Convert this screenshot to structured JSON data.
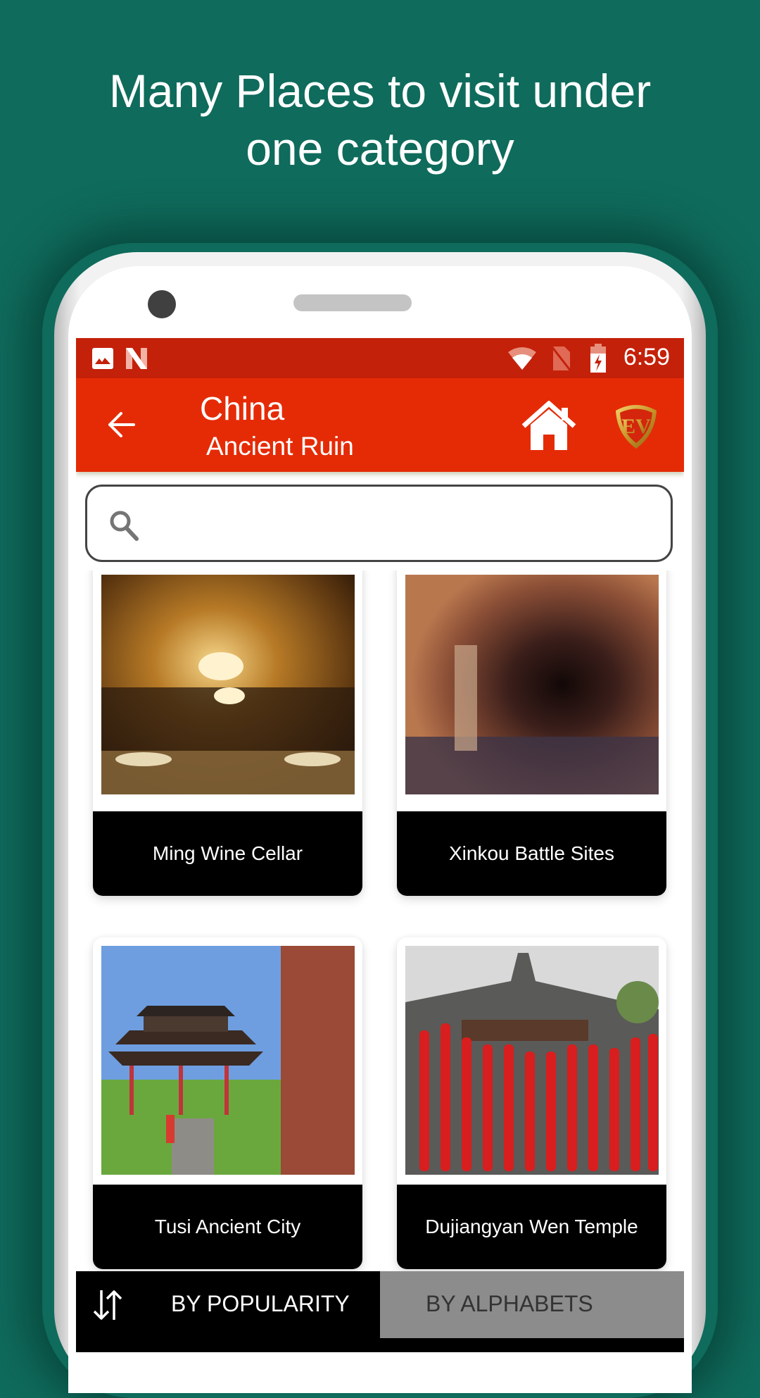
{
  "promo": {
    "headline_line1": "Many Places to visit under",
    "headline_line2": "one category"
  },
  "status_bar": {
    "time": "6:59",
    "icons": [
      "gallery-icon",
      "n-notification-icon",
      "wifi-icon",
      "no-sim-icon",
      "battery-charging-icon"
    ]
  },
  "app_bar": {
    "title": "China",
    "subtitle": "Ancient Ruin",
    "back_icon": "arrow-left-icon",
    "home_icon": "home-icon",
    "logo_text": "EV"
  },
  "search": {
    "placeholder": "",
    "value": "",
    "icon": "search-icon"
  },
  "places": [
    {
      "name": "Ming Wine Cellar",
      "image": "restaurant interior with chandeliers"
    },
    {
      "name": "Xinkou Battle Sites",
      "image": "brick tunnel"
    },
    {
      "name": "Tusi Ancient City",
      "image": "pagoda pavilion under blue sky"
    },
    {
      "name": "Dujiangyan Wen Temple",
      "image": "stone gate with red lanterns"
    }
  ],
  "sort_bar": {
    "icon": "sort-icon",
    "tabs": [
      {
        "label": "BY POPULARITY",
        "active": true
      },
      {
        "label": "BY ALPHABETS",
        "active": false
      }
    ]
  },
  "colors": {
    "background": "#0f6b5c",
    "status_bar": "#c4210a",
    "app_bar": "#e52b06",
    "caption_bg": "#000000",
    "inactive_tab": "#8c8c8c"
  }
}
